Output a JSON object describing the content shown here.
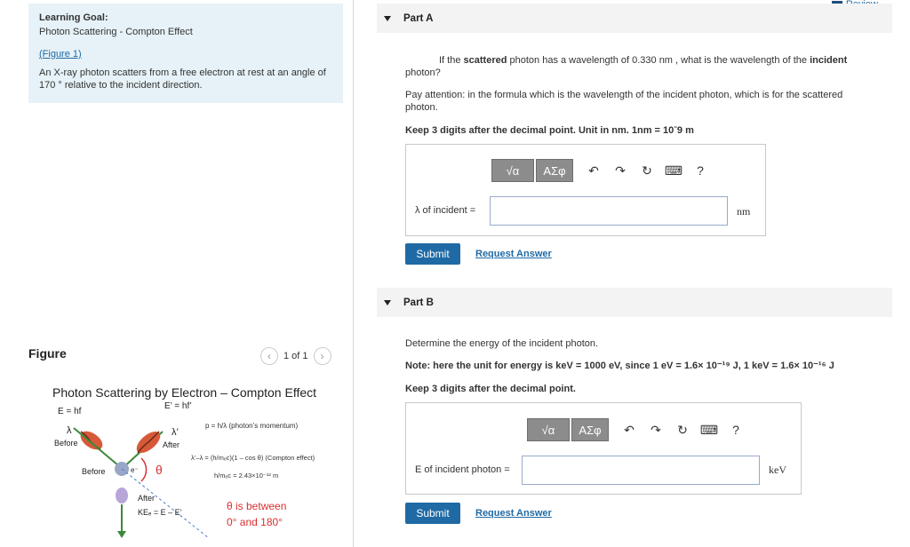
{
  "goal": {
    "title": "Learning Goal:",
    "subtitle": "Photon Scattering - Compton Effect",
    "figure_link": "(Figure 1)",
    "description": "An X-ray photon scatters from a free electron at rest at an angle of 170 ° relative to the incident direction."
  },
  "figure_panel": {
    "label": "Figure",
    "pager": "1 of 1",
    "title": "Photon Scattering by Electron – Compton Effect",
    "e_hf": "E = hf",
    "e_prime": "E’ = hf’",
    "lambda": "λ",
    "lambda_prime": "λ’",
    "before": "Before",
    "after": "After",
    "before2": "Before",
    "after2": "After",
    "e_minus": "e⁻",
    "theta": "θ",
    "ke": "KEₑ = E – E’",
    "momentum": "p = h/λ  (photon’s momentum)",
    "compton": "λ’–λ = (h/mₑc)(1 – cos θ) (Compton effect)",
    "constant": "h/mₑc = 2.43×10⁻¹² m",
    "theta_range1": "θ is between",
    "theta_range2": "0° and 180°"
  },
  "review_link": "Review",
  "partA": {
    "label": "Part A",
    "question_pre": "If the ",
    "question_bold1": "scattered",
    "question_mid": " photon has a wavelength of 0.330 nm , what is the wavelength of the ",
    "question_bold2": "incident",
    "question_post": " photon?",
    "note": "Pay attention: in the formula which is the wavelength of the incident photon, which is for the scattered photon.",
    "instruction": "Keep 3 digits after the decimal point. Unit in nm. 1nm = 10ˉ9 m",
    "field_label": "λ of incident  =",
    "unit": "nm",
    "submit": "Submit",
    "request": "Request Answer"
  },
  "partB": {
    "label": "Part B",
    "question": "Determine the energy of the incident photon.",
    "note": "Note: here the unit for energy is keV = 1000 eV, since 1 eV = 1.6× 10⁻¹⁹ J, 1 keV = 1.6× 10⁻¹⁶ J",
    "instruction": "Keep 3 digits after the decimal point.",
    "field_label": "E of incident photon =",
    "unit": "keV",
    "submit": "Submit",
    "request": "Request Answer"
  },
  "toolbar": {
    "template": "√α",
    "greek": "ΑΣφ",
    "undo": "↶",
    "redo": "↷",
    "reset": "↻",
    "keyboard": "⌨",
    "help": "?"
  }
}
